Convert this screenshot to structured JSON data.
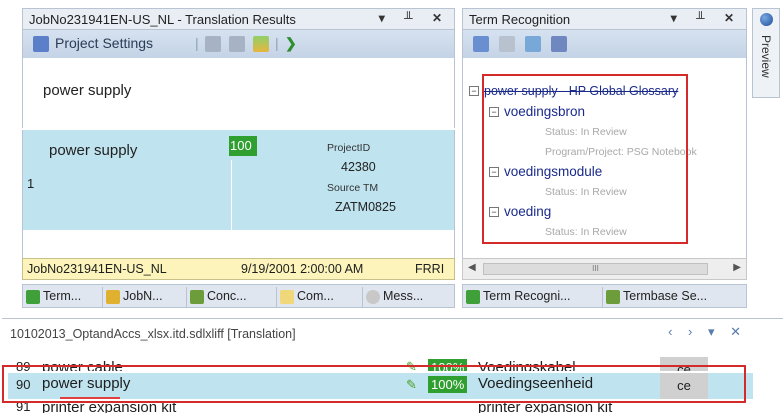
{
  "translation_results": {
    "title": "JobNo231941EN-US_NL - Translation Results",
    "toolbar": {
      "project_settings": "Project Settings"
    },
    "source_segment": "power supply",
    "match": {
      "text": "power supply",
      "row_number": "1",
      "match_percent": "100",
      "project_id_label": "ProjectID",
      "project_id_value": "42380",
      "source_tm_label": "Source TM",
      "source_tm_value": "ZATM0825"
    },
    "status_bar": {
      "job": "JobNo231941EN-US_NL",
      "date": "9/19/2001 2:00:00 AM",
      "user": "FRRI"
    }
  },
  "left_tabs": [
    "Term...",
    "JobN...",
    "Conc...",
    "Com...",
    "Mess..."
  ],
  "term_recognition": {
    "title": "Term Recognition",
    "header": "power supply - HP Global Glossary",
    "entries": [
      {
        "term": "voedingsbron",
        "details": [
          "Status: In Review",
          "Program/Project: PSG Notebook"
        ]
      },
      {
        "term": "voedingsmodule",
        "details": [
          "Status: In Review"
        ]
      },
      {
        "term": "voeding",
        "details": [
          "Status: In Review"
        ]
      }
    ],
    "scroll_label": "III"
  },
  "right_tabs": [
    "Term Recogni...",
    "Termbase Se..."
  ],
  "preview": {
    "label": "Preview"
  },
  "editor": {
    "title": "10102013_OptandAccs_xlsx.itd.sdlxliff [Translation]",
    "rows": [
      {
        "num": "89",
        "source": "power cable",
        "match": "100%",
        "target": "Voedingskabel",
        "status": "ce"
      },
      {
        "num": "90",
        "source": "power supply",
        "match": "100%",
        "target": "Voedingseenheid",
        "status": "ce"
      },
      {
        "num": "91",
        "source": "printer expansion kit",
        "match": "",
        "target": "printer expansion kit",
        "status": ""
      }
    ]
  },
  "colors": {
    "match_green": "#2fa02f",
    "highlight_row": "#bfe3ef",
    "status_yellow": "#fcf4bb",
    "annotation_red": "#d42a2a"
  }
}
